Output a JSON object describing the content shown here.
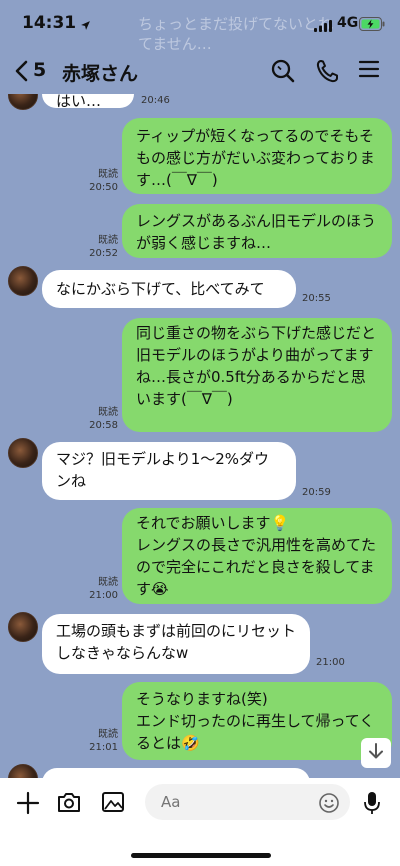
{
  "status": {
    "time": "14:31",
    "network": "4G"
  },
  "background_preview": "ちょっとまだ投げてないとれてません…",
  "header": {
    "unread_count": "5",
    "title": "赤塚さん"
  },
  "messages": [
    {
      "dir": "in",
      "text": "はい…",
      "time": "20:46",
      "read": ""
    },
    {
      "dir": "out",
      "text": "ティップが短くなってるのでそもそもの感じ方がだいぶ変わっております…(￣∇￣)",
      "time": "20:50",
      "read": "既読"
    },
    {
      "dir": "out",
      "text": "レングスがあるぶん旧モデルのほうが弱く感じますね…",
      "time": "20:52",
      "read": "既読"
    },
    {
      "dir": "in",
      "text": "なにかぶら下げて、比べてみて",
      "time": "20:55",
      "read": ""
    },
    {
      "dir": "out",
      "text": "同じ重さの物をぶら下げた感じだと\n旧モデルのほうがより曲がってますね…長さが0.5ft分あるからだと思います(￣∇￣)",
      "time": "20:58",
      "read": "既読"
    },
    {
      "dir": "in",
      "text": "マジ？旧モデルより1〜2%ダウンね",
      "time": "20:59",
      "read": ""
    },
    {
      "dir": "out",
      "text": "それでお願いします💡\nレングスの長さで汎用性を高めてたので完全にこれだと良さを殺してます😭",
      "time": "21:00",
      "read": "既読"
    },
    {
      "dir": "in",
      "text": "工場の頭もまずは前回のにリセットしなきゃならんなw",
      "time": "21:00",
      "read": ""
    },
    {
      "dir": "out",
      "text": "そうなりますね(笑)\nエンド切ったのに再生して帰ってくるとは🤣",
      "time": "21:01",
      "read": "既読"
    }
  ],
  "input": {
    "placeholder": "Aa"
  },
  "colors": {
    "background": "#8da0c6",
    "outgoing_bubble": "#86d96d",
    "incoming_bubble": "#ffffff"
  },
  "icons": [
    "location-arrow-icon",
    "signal-icon",
    "battery-charging-icon",
    "back-chevron-icon",
    "search-icon",
    "phone-icon",
    "menu-icon",
    "plus-icon",
    "camera-icon",
    "image-icon",
    "emoji-icon",
    "microphone-icon",
    "arrow-down-icon"
  ]
}
